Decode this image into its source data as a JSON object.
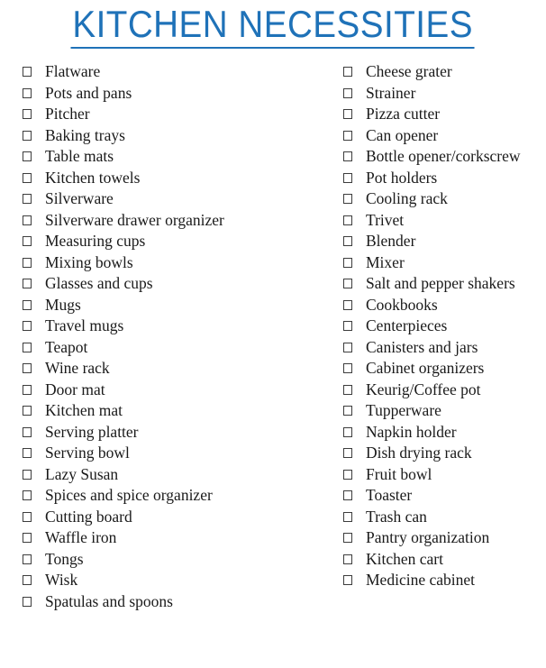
{
  "document": {
    "title": "KITCHEN NECESSITIES",
    "title_color": "#1f72b8",
    "text_color": "#1a1a1a",
    "background_color": "#ffffff",
    "checkbox_icon": "empty-checkbox"
  },
  "left_column": {
    "items": [
      {
        "label": "Flatware"
      },
      {
        "label": "Pots and pans"
      },
      {
        "label": "Pitcher"
      },
      {
        "label": "Baking trays"
      },
      {
        "label": "Table mats"
      },
      {
        "label": "Kitchen towels"
      },
      {
        "label": "Silverware"
      },
      {
        "label": "Silverware drawer organizer"
      },
      {
        "label": "Measuring cups"
      },
      {
        "label": "Mixing bowls"
      },
      {
        "label": "Glasses and cups"
      },
      {
        "label": "Mugs"
      },
      {
        "label": "Travel mugs"
      },
      {
        "label": "Teapot"
      },
      {
        "label": "Wine rack"
      },
      {
        "label": "Door mat"
      },
      {
        "label": "Kitchen mat"
      },
      {
        "label": "Serving platter"
      },
      {
        "label": "Serving bowl"
      },
      {
        "label": "Lazy Susan"
      },
      {
        "label": "Spices and spice organizer"
      },
      {
        "label": "Cutting board"
      },
      {
        "label": "Waffle iron"
      },
      {
        "label": "Tongs"
      },
      {
        "label": "Wisk"
      },
      {
        "label": "Spatulas and spoons"
      }
    ]
  },
  "right_column": {
    "items": [
      {
        "label": "Cheese grater"
      },
      {
        "label": "Strainer"
      },
      {
        "label": "Pizza cutter"
      },
      {
        "label": "Can opener"
      },
      {
        "label": "Bottle opener/corkscrew"
      },
      {
        "label": "Pot holders"
      },
      {
        "label": "Cooling rack"
      },
      {
        "label": "Trivet"
      },
      {
        "label": "Blender"
      },
      {
        "label": "Mixer"
      },
      {
        "label": "Salt and pepper shakers"
      },
      {
        "label": "Cookbooks"
      },
      {
        "label": "Centerpieces"
      },
      {
        "label": "Canisters and jars"
      },
      {
        "label": "Cabinet organizers"
      },
      {
        "label": "Keurig/Coffee pot"
      },
      {
        "label": "Tupperware"
      },
      {
        "label": "Napkin holder"
      },
      {
        "label": "Dish drying rack"
      },
      {
        "label": "Fruit bowl"
      },
      {
        "label": "Toaster"
      },
      {
        "label": "Trash can"
      },
      {
        "label": "Pantry organization"
      },
      {
        "label": "Kitchen cart"
      },
      {
        "label": "Medicine cabinet"
      }
    ]
  }
}
